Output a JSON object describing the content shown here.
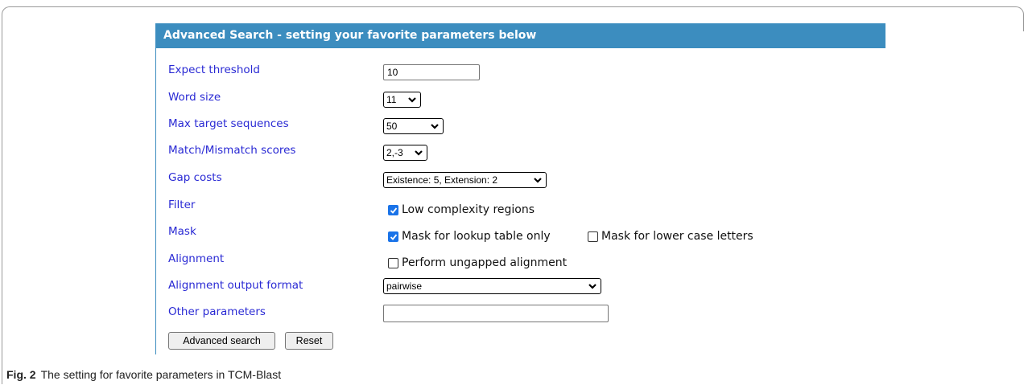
{
  "header": {
    "title": "Advanced Search - setting your favorite parameters below"
  },
  "form": {
    "expect_threshold": {
      "label": "Expect threshold",
      "value": "10"
    },
    "word_size": {
      "label": "Word size",
      "selected": "11"
    },
    "max_target_sequences": {
      "label": "Max target sequences",
      "selected": "50"
    },
    "match_mismatch": {
      "label": "Match/Mismatch scores",
      "selected": "2,-3"
    },
    "gap_costs": {
      "label": "Gap costs",
      "selected": "Existence: 5, Extension: 2"
    },
    "filter": {
      "label": "Filter",
      "options": [
        {
          "text": "Low complexity regions",
          "checked": true
        }
      ]
    },
    "mask": {
      "label": "Mask",
      "options": [
        {
          "text": "Mask for lookup table only",
          "checked": true
        },
        {
          "text": "Mask for lower case letters",
          "checked": false
        }
      ]
    },
    "alignment": {
      "label": "Alignment",
      "options": [
        {
          "text": "Perform ungapped alignment",
          "checked": false
        }
      ]
    },
    "alignment_output_format": {
      "label": "Alignment output format",
      "selected": "pairwise"
    },
    "other_parameters": {
      "label": "Other parameters",
      "value": ""
    }
  },
  "buttons": {
    "advanced_search": "Advanced search",
    "reset": "Reset"
  },
  "caption": {
    "fig": "Fig. 2",
    "text": "The setting for favorite parameters in TCM-Blast"
  },
  "colors": {
    "header_bg": "#3c8dbf",
    "label_text": "#2a2ad4",
    "checkbox_checked": "#1a73e8"
  }
}
